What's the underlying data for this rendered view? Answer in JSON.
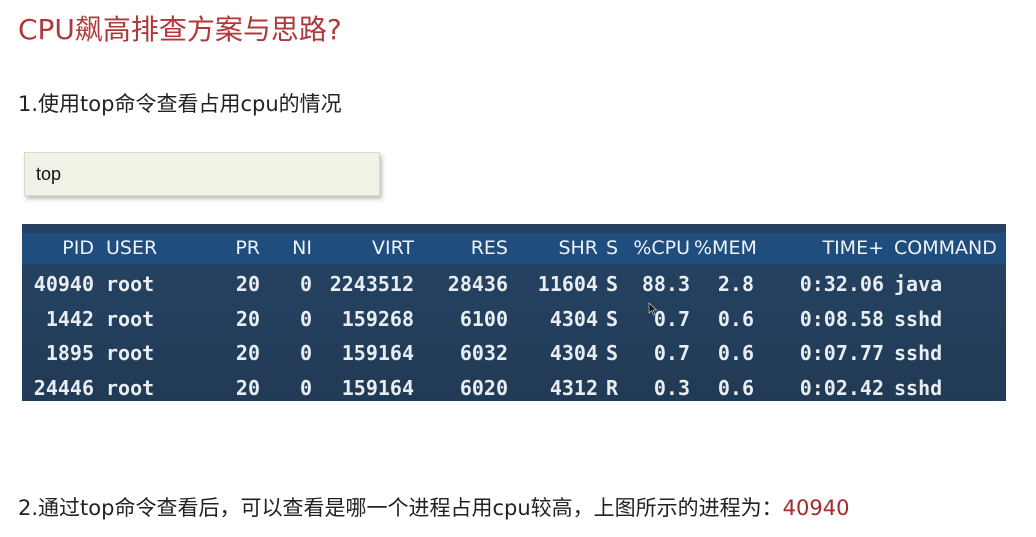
{
  "title": "CPU飙高排查方案与思路?",
  "step1": "1.使用top命令查看占用cpu的情况",
  "command": "top",
  "table": {
    "headers": [
      "PID",
      "USER",
      "PR",
      "NI",
      "VIRT",
      "RES",
      "SHR",
      "S",
      "%CPU",
      "%MEM",
      "TIME+",
      "COMMAND"
    ],
    "rows": [
      {
        "pid": "40940",
        "user": "root",
        "pr": "20",
        "ni": "0",
        "virt": "2243512",
        "res": "28436",
        "shr": "11604",
        "s": "S",
        "cpu": "88.3",
        "mem": "2.8",
        "time": "0:32.06",
        "command": "java"
      },
      {
        "pid": "1442",
        "user": "root",
        "pr": "20",
        "ni": "0",
        "virt": "159268",
        "res": "6100",
        "shr": "4304",
        "s": "S",
        "cpu": "0.7",
        "mem": "0.6",
        "time": "0:08.58",
        "command": "sshd"
      },
      {
        "pid": "1895",
        "user": "root",
        "pr": "20",
        "ni": "0",
        "virt": "159164",
        "res": "6032",
        "shr": "4304",
        "s": "S",
        "cpu": "0.7",
        "mem": "0.6",
        "time": "0:07.77",
        "command": "sshd"
      },
      {
        "pid": "24446",
        "user": "root",
        "pr": "20",
        "ni": "0",
        "virt": "159164",
        "res": "6020",
        "shr": "4312",
        "s": "R",
        "cpu": "0.3",
        "mem": "0.6",
        "time": "0:02.42",
        "command": "sshd"
      }
    ]
  },
  "step2": {
    "text": "2.通过top命令查看后，可以查看是哪一个进程占用cpu较高，上图所示的进程为：",
    "highlight": "40940"
  },
  "colors": {
    "title": "#b0383a",
    "highlight": "#a62a2a",
    "terminal_bg": "#23405e",
    "terminal_header": "#1e4d7e"
  }
}
